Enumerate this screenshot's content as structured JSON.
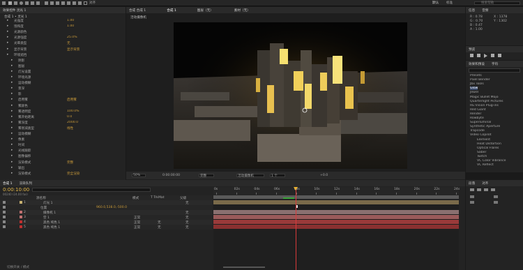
{
  "toolbar": {
    "ps_label": "对齐",
    "right": [
      "默认",
      "标准"
    ],
    "search_placeholder": "搜索帮助"
  },
  "effect_panel": {
    "tab": "效果控件 灵光 1",
    "path": "合成 1 • 灵光 1",
    "rows": [
      {
        "label": "光强度",
        "value": "1.00"
      },
      {
        "label": "饱和度",
        "value": "1.00"
      },
      {
        "label": "光源颜色",
        "value": ""
      },
      {
        "label": "光源强度",
        "value": "25.0%"
      },
      {
        "label": "光晕类型",
        "value": "无"
      },
      {
        "label": "显示背景",
        "value": "显示背景"
      },
      {
        "label": "环境遮挡",
        "value": ""
      },
      {
        "label": "阴影",
        "value": ""
      },
      {
        "label": "图层",
        "value": ""
      },
      {
        "label": "灯光设置",
        "value": ""
      },
      {
        "label": "环境光源",
        "value": ""
      },
      {
        "label": "运动模糊",
        "value": ""
      },
      {
        "label": "景深",
        "value": ""
      },
      {
        "label": "影",
        "value": ""
      },
      {
        "label": "启用雾",
        "value": "启用雾"
      },
      {
        "label": "雾颜色",
        "value": ""
      },
      {
        "label": "雾透明度",
        "value": "100.0%"
      },
      {
        "label": "雾开始距离",
        "value": "0.0"
      },
      {
        "label": "雾深度",
        "value": "2000.0"
      },
      {
        "label": "雾衰减类型",
        "value": "线性"
      },
      {
        "label": "运动模糊",
        "value": ""
      },
      {
        "label": "像素",
        "value": ""
      },
      {
        "label": "时间",
        "value": ""
      },
      {
        "label": "光线跟踪",
        "value": ""
      },
      {
        "label": "图像偏移",
        "value": ""
      },
      {
        "label": "渲染模式",
        "value": "完整"
      },
      {
        "label": "输出",
        "value": ""
      },
      {
        "label": "渲染模式",
        "value": "完全渲染"
      }
    ]
  },
  "comp": {
    "tabs": [
      "合成 合成 1",
      "合成 1",
      "图层（无）",
      "素材（无）"
    ],
    "camera_label": "活动摄像机",
    "footer": {
      "zoom": "50%",
      "time": "0:00:00:00",
      "res": "完整",
      "view": "活动摄像机",
      "views": "1 个",
      "offset": "+0.0"
    }
  },
  "info": {
    "tab1": "信息",
    "tab2": "音频",
    "r": "R : 0.78",
    "g": "G : 0.70",
    "b": "B : 0.47",
    "a": "A : 1.00",
    "x": "X : 1378",
    "y": "Y : 1302"
  },
  "preview": {
    "tab": "预览"
  },
  "effects_presets": {
    "tab": "效果和预设",
    "tab2": "字符",
    "search": "",
    "items": [
      "Presets",
      "Pixel Bender",
      "Jbx Tools",
      "Glow",
      "Jewel",
      "Magic Bullet Mojo",
      "Quarterlight Pictures",
      "RE:Vision Plug-ins",
      "Red Giant",
      "Render",
      "Rowbyte",
      "Superluminal",
      "Synthetic Aperture",
      "Trapcode",
      "Video Copilot",
      "Element",
      "Heat Distortion",
      "Optical Flares",
      "Saber",
      "Twitch",
      "VC Color Vibrance",
      "VC Reflect"
    ],
    "selected": "Glow"
  },
  "align": {
    "tab": "段落",
    "tab2": "对齐"
  },
  "timeline": {
    "tabs": [
      "合成 1",
      "渲染队列"
    ],
    "timecode": "0:00:10:00",
    "frame_info": "00240 (24.00 fps)",
    "col_headers": [
      "源名称",
      "模式",
      "T TrkMat",
      "父级"
    ],
    "ruler": [
      "0s",
      "02s",
      "04s",
      "06s",
      "08s",
      "10s",
      "12s",
      "14s",
      "16s",
      "18s",
      "20s",
      "22s",
      "24s"
    ],
    "layers": [
      {
        "num": "1",
        "name": "灯光 1",
        "mode": "",
        "trk": "",
        "parent": "无",
        "color": "#c8b070"
      },
      {
        "num": "",
        "name": "位置",
        "mode": "",
        "trk": "",
        "parent": "",
        "value": "960.0,538.0,-500.0"
      },
      {
        "num": "2",
        "name": "摄像机 1",
        "mode": "",
        "trk": "",
        "parent": "无",
        "color": "#c07070"
      },
      {
        "num": "3",
        "name": "空 1",
        "mode": "正常",
        "trk": "",
        "parent": "无",
        "color": "#c07070"
      },
      {
        "num": "4",
        "name": "黑色 纯色 1",
        "mode": "正常",
        "trk": "无",
        "parent": "无",
        "color": "#c03030"
      },
      {
        "num": "5",
        "name": "黑色 纯色 1",
        "mode": "正常",
        "trk": "无",
        "parent": "无",
        "color": "#c03030"
      }
    ],
    "footer": "切换开关 / 模式"
  }
}
